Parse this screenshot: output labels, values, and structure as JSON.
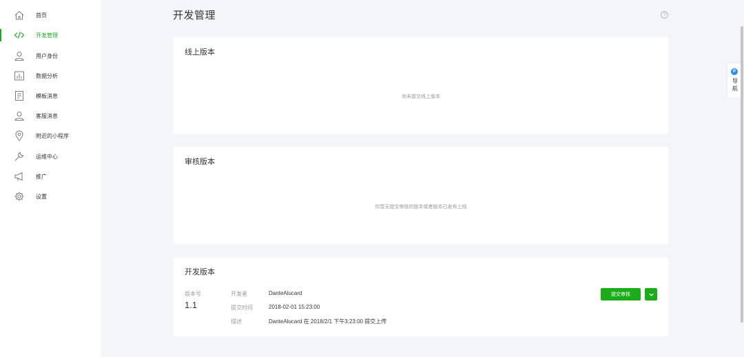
{
  "sidebar": {
    "items": [
      {
        "label": "首页",
        "icon": "home-icon"
      },
      {
        "label": "开发管理",
        "icon": "code-icon",
        "active": true
      },
      {
        "label": "用户身份",
        "icon": "user-icon"
      },
      {
        "label": "数据分析",
        "icon": "chart-icon"
      },
      {
        "label": "模板消息",
        "icon": "template-icon"
      },
      {
        "label": "客服消息",
        "icon": "service-icon"
      },
      {
        "label": "附近的小程序",
        "icon": "location-icon"
      },
      {
        "label": "运维中心",
        "icon": "wrench-icon"
      },
      {
        "label": "推广",
        "icon": "megaphone-icon"
      },
      {
        "label": "设置",
        "icon": "gear-icon"
      }
    ]
  },
  "header": {
    "title": "开发管理",
    "help": "?"
  },
  "online": {
    "title": "线上版本",
    "empty": "尚未提交线上版本"
  },
  "review": {
    "title": "审核版本",
    "empty": "你暂无提交审核的版本或者版本已发布上线"
  },
  "dev": {
    "title": "开发版本",
    "version_label": "版本号",
    "version": "1.1",
    "developer_label": "开发者",
    "developer": "DanteAlucard",
    "time_label": "提交时间",
    "time": "2018-02-01 15:23:00",
    "desc_label": "描述",
    "desc": "DanteAlucard 在 2018/2/1 下午3:23:00 提交上传",
    "submit_label": "提交审核"
  },
  "float_nav": {
    "badge": "P",
    "line1": "导",
    "line2": "航"
  },
  "colors": {
    "accent": "#1aad19",
    "background": "#f4f5f9"
  }
}
